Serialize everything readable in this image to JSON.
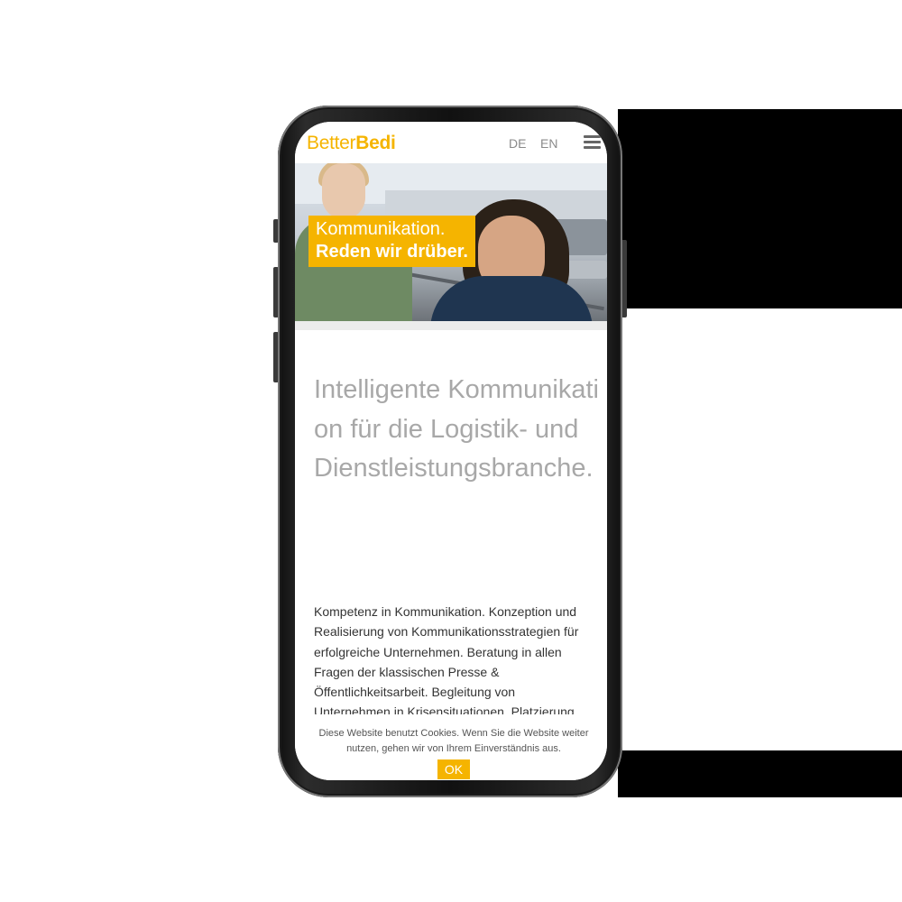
{
  "site": {
    "logo": {
      "light": "Better",
      "bold": "Bedi"
    },
    "languages": [
      "DE",
      "EN"
    ],
    "menu_icon": "hamburger-icon",
    "accent_color": "#f5b400"
  },
  "hero": {
    "tagline_line1": "Kommunikation.",
    "tagline_line2": "Reden wir drüber."
  },
  "main": {
    "headline": "Intelligente Kommunikation für die Logistik- und Dienstleistungsbranche.",
    "body": "Kompetenz in Kommunikation. Konzeption und Realisierung von Kommunikationsstrategien für erfolgreiche Unternehmen. Beratung in allen Fragen der klassischen Presse & Öffentlichkeitsarbeit. Begleitung von Unternehmen in Krisensituationen. Platzierung"
  },
  "cookie_banner": {
    "text": "Diese Website benutzt Cookies. Wenn Sie die Website weiter nutzen, gehen wir von Ihrem Einverständnis aus.",
    "ok_label": "OK"
  }
}
